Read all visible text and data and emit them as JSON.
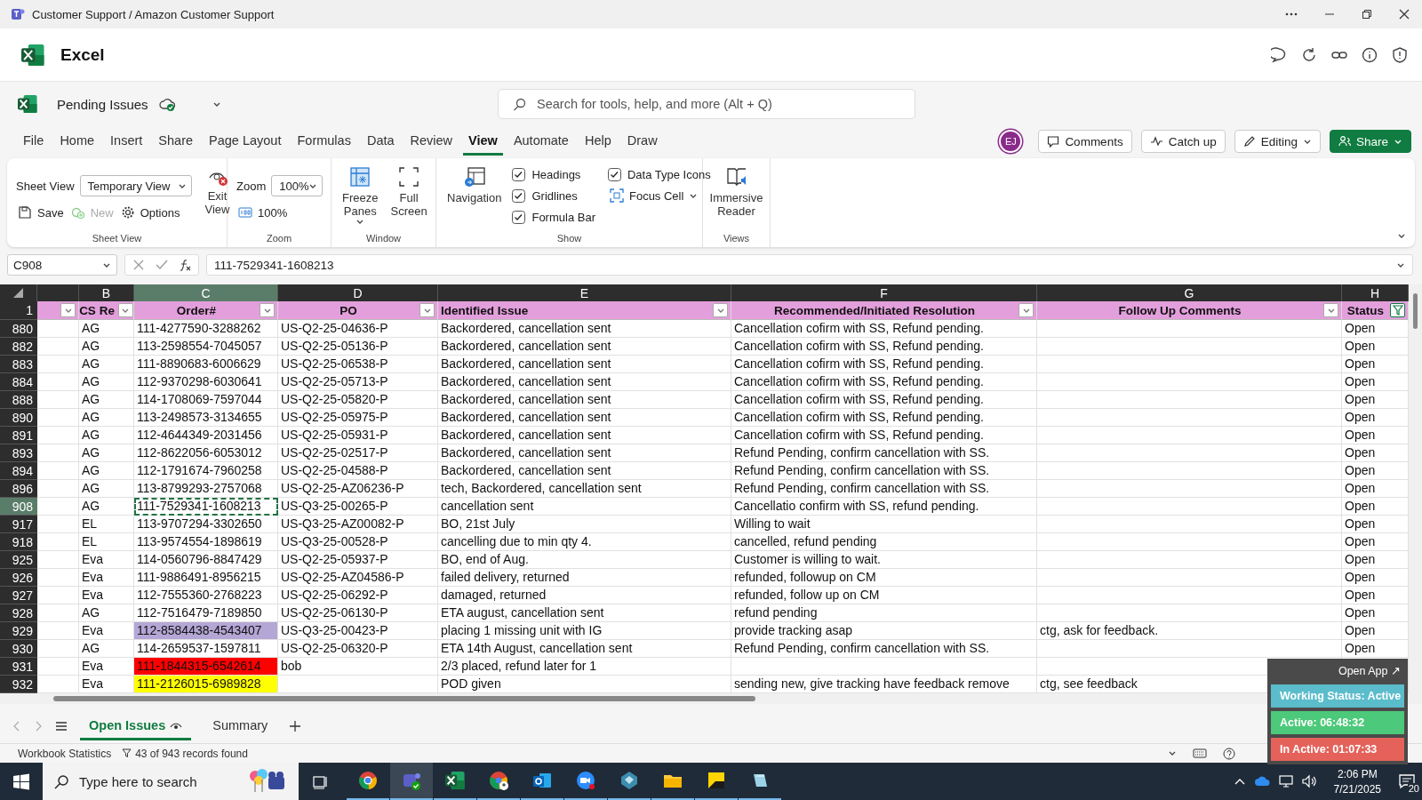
{
  "window": {
    "title": "Customer Support / Amazon Customer Support"
  },
  "app": {
    "name": "Excel"
  },
  "document": {
    "name": "Pending Issues"
  },
  "search": {
    "placeholder": "Search for tools, help, and more (Alt + Q)"
  },
  "menu_tabs": [
    {
      "label": "File",
      "selected": false
    },
    {
      "label": "Home",
      "selected": false
    },
    {
      "label": "Insert",
      "selected": false
    },
    {
      "label": "Share",
      "selected": false
    },
    {
      "label": "Page Layout",
      "selected": false
    },
    {
      "label": "Formulas",
      "selected": false
    },
    {
      "label": "Data",
      "selected": false
    },
    {
      "label": "Review",
      "selected": false
    },
    {
      "label": "View",
      "selected": true
    },
    {
      "label": "Automate",
      "selected": false
    },
    {
      "label": "Help",
      "selected": false
    },
    {
      "label": "Draw",
      "selected": false
    }
  ],
  "user": {
    "initials": "EJ"
  },
  "actions": {
    "comments": "Comments",
    "catch_up": "Catch up",
    "editing": "Editing",
    "share": "Share"
  },
  "ribbon": {
    "sheet_view": {
      "label": "Sheet View",
      "value": "Temporary View",
      "buttons": [
        {
          "label": "Save",
          "disabled": false
        },
        {
          "label": "New",
          "disabled": true
        },
        {
          "label": "Options",
          "disabled": false
        }
      ],
      "exit": "Exit View",
      "title": "Sheet View"
    },
    "zoom": {
      "label": "Zoom",
      "value": "100%",
      "reset": "100%",
      "title": "Zoom"
    },
    "window": {
      "buttons": [
        {
          "label": "Freeze Panes",
          "dropdown": true
        },
        {
          "label": "Full Screen",
          "dropdown": false
        }
      ],
      "title": "Window"
    },
    "show": {
      "navigation": "Navigation",
      "options": [
        {
          "label": "Headings",
          "checked": true
        },
        {
          "label": "Gridlines",
          "checked": true
        },
        {
          "label": "Formula Bar",
          "checked": true
        },
        {
          "label": "Data Type Icons",
          "checked": true
        }
      ],
      "focus_cell": "Focus Cell",
      "title": "Show"
    },
    "views": {
      "button": "Immersive Reader",
      "title": "Views"
    }
  },
  "formula_bar": {
    "name_box": "C908",
    "value": "111-7529341-1608213"
  },
  "sheet": {
    "header_row": "1",
    "columns": [
      {
        "letter": "B",
        "label": "CS Re",
        "selected": false,
        "filtered": false
      },
      {
        "letter": "C",
        "label": "Order#",
        "selected": true,
        "filtered": false
      },
      {
        "letter": "D",
        "label": "PO",
        "selected": false,
        "filtered": false
      },
      {
        "letter": "E",
        "label": "Identified Issue",
        "selected": false,
        "filtered": false
      },
      {
        "letter": "F",
        "label": "Recommended/Initiated Resolution",
        "selected": false,
        "filtered": false
      },
      {
        "letter": "G",
        "label": "Follow Up Comments",
        "selected": false,
        "filtered": false
      },
      {
        "letter": "H",
        "label": "Status",
        "selected": false,
        "filtered": true
      }
    ],
    "rows": [
      {
        "number": "880",
        "selected": false,
        "cs_rep": "AG",
        "order": "111-4277590-3288262",
        "po": "US-Q2-25-04636-P",
        "issue": "Backordered, cancellation sent",
        "resolution": "Cancellation cofirm with SS, Refund pending.",
        "status": "Open"
      },
      {
        "number": "882",
        "selected": false,
        "cs_rep": "AG",
        "order": "113-2598554-7045057",
        "po": "US-Q2-25-05136-P",
        "issue": "Backordered, cancellation sent",
        "resolution": "Cancellation cofirm with SS, Refund pending.",
        "status": "Open"
      },
      {
        "number": "883",
        "selected": false,
        "cs_rep": "AG",
        "order": "111-8890683-6006629",
        "po": "US-Q2-25-06538-P",
        "issue": "Backordered, cancellation sent",
        "resolution": "Cancellation cofirm with SS, Refund pending.",
        "status": "Open"
      },
      {
        "number": "884",
        "selected": false,
        "cs_rep": "AG",
        "order": "112-9370298-6030641",
        "po": "US-Q2-25-05713-P",
        "issue": "Backordered, cancellation sent",
        "resolution": "Cancellation cofirm with SS, Refund pending.",
        "status": "Open"
      },
      {
        "number": "888",
        "selected": false,
        "cs_rep": "AG",
        "order": "114-1708069-7597044",
        "po": "US-Q2-25-05820-P",
        "issue": "Backordered, cancellation sent",
        "resolution": "Cancellation cofirm with SS, Refund pending.",
        "status": "Open"
      },
      {
        "number": "890",
        "selected": false,
        "cs_rep": "AG",
        "order": "113-2498573-3134655",
        "po": "US-Q2-25-05975-P",
        "issue": "Backordered, cancellation sent",
        "resolution": "Cancellation cofirm with SS, Refund pending.",
        "status": "Open"
      },
      {
        "number": "891",
        "selected": false,
        "cs_rep": "AG",
        "order": "112-4644349-2031456",
        "po": "US-Q2-25-05931-P",
        "issue": "Backordered, cancellation sent",
        "resolution": "Cancellation cofirm with SS, Refund pending.",
        "status": "Open"
      },
      {
        "number": "893",
        "selected": false,
        "cs_rep": "AG",
        "order": "112-8622056-6053012",
        "po": "US-Q2-25-02517-P",
        "issue": "Backordered, cancellation sent",
        "resolution": "Refund Pending, confirm cancellation with SS.",
        "status": "Open"
      },
      {
        "number": "894",
        "selected": false,
        "cs_rep": "AG",
        "order": "112-1791674-7960258",
        "po": "US-Q2-25-04588-P",
        "issue": "Backordered, cancellation sent",
        "resolution": "Refund Pending, confirm cancellation with SS.",
        "status": "Open"
      },
      {
        "number": "896",
        "selected": false,
        "cs_rep": "AG",
        "order": "113-8799293-2757068",
        "po": "US-Q2-25-AZ06236-P",
        "issue": "tech, Backordered, cancellation sent",
        "resolution": "Refund Pending, confirm cancellation with SS.",
        "status": "Open"
      },
      {
        "number": "908",
        "selected": true,
        "cs_rep": "AG",
        "order": "111-7529341-1608213",
        "po": "US-Q3-25-00265-P",
        "issue": "cancellation sent",
        "resolution": "Cancellatio confirm with SS, refund pending.",
        "status": "Open"
      },
      {
        "number": "917",
        "selected": false,
        "cs_rep": "EL",
        "order": "113-9707294-3302650",
        "po": "US-Q3-25-AZ00082-P",
        "issue": "BO, 21st July",
        "resolution": "Willing to wait",
        "status": "Open"
      },
      {
        "number": "918",
        "selected": false,
        "cs_rep": "EL",
        "order": "113-9574554-1898619",
        "po": "US-Q3-25-00528-P",
        "issue": "cancelling due to min qty 4.",
        "resolution": "cancelled, refund pending",
        "status": "Open"
      },
      {
        "number": "925",
        "selected": false,
        "cs_rep": "Eva",
        "order": "114-0560796-8847429",
        "po": "US-Q2-25-05937-P",
        "issue": "BO, end of Aug.",
        "resolution": "Customer is willing to wait.",
        "status": "Open"
      },
      {
        "number": "926",
        "selected": false,
        "cs_rep": "Eva",
        "order": "111-9886491-8956215",
        "po": "US-Q2-25-AZ04586-P",
        "issue": "failed delivery, returned",
        "resolution": "refunded, followup on CM",
        "status": "Open"
      },
      {
        "number": "927",
        "selected": false,
        "cs_rep": "Eva",
        "order": "112-7555360-2768223",
        "po": "US-Q2-25-06292-P",
        "issue": "damaged, returned",
        "resolution": "refunded, follow up on CM",
        "status": "Open"
      },
      {
        "number": "928",
        "selected": false,
        "cs_rep": "AG",
        "order": "112-7516479-7189850",
        "po": "US-Q2-25-06130-P",
        "issue": "ETA august, cancellation sent",
        "resolution": "refund pending",
        "status": "Open"
      },
      {
        "number": "929",
        "selected": false,
        "cs_rep": "Eva",
        "order": "112-8584438-4543407",
        "color": "#b4a7d6",
        "po": "US-Q3-25-00423-P",
        "issue": "placing 1 missing unit with IG",
        "resolution": "provide tracking asap",
        "follow_up": "ctg, ask for feedback.",
        "status": "Open"
      },
      {
        "number": "930",
        "selected": false,
        "cs_rep": "AG",
        "order": "114-2659537-1597811",
        "po": "US-Q2-25-06320-P",
        "issue": "ETA 14th August, cancellation sent",
        "resolution": "Refund Pending, confirm cancellation with SS.",
        "status": "Open"
      },
      {
        "number": "931",
        "selected": false,
        "cs_rep": "Eva",
        "order": "111-1844315-6542614",
        "color": "#ff0000",
        "po": "bob",
        "issue": "2/3 placed, refund later for 1"
      },
      {
        "number": "932",
        "selected": false,
        "cs_rep": "Eva",
        "order": "111-2126015-6989828",
        "color": "#ffff00",
        "issue": "POD given",
        "resolution": "sending new, give tracking have feedback remove",
        "follow_up": "ctg, see feedback"
      }
    ]
  },
  "sheet_tabs": [
    {
      "label": "Open Issues",
      "selected": true
    },
    {
      "label": "Summary",
      "selected": false
    }
  ],
  "status_bar": {
    "statistics": "Workbook Statistics",
    "records": "43 of 943 records found"
  },
  "tracker": {
    "link": "Open App ↗",
    "status": "Working Status: Active",
    "active": "Active: 06:48:32",
    "inactive": "In Active: 01:07:33"
  },
  "taskbar": {
    "search_placeholder": "Type here to search",
    "apps": [
      {
        "kind": "browser",
        "selected": false
      },
      {
        "kind": "chat",
        "selected": true
      },
      {
        "kind": "sheet",
        "selected": false
      },
      {
        "kind": "browser-profile",
        "selected": false
      },
      {
        "kind": "mail",
        "selected": false
      },
      {
        "kind": "video",
        "selected": false
      },
      {
        "kind": "gem",
        "selected": false
      },
      {
        "kind": "folder",
        "selected": false
      },
      {
        "kind": "note",
        "selected": false
      },
      {
        "kind": "pad",
        "selected": false
      }
    ],
    "time": "2:06 PM",
    "date": "7/21/2025",
    "notifications": "20"
  }
}
